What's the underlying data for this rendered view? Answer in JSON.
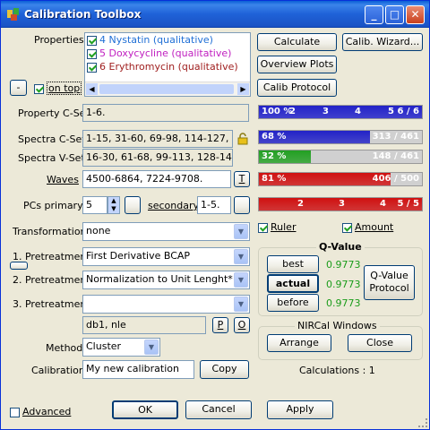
{
  "window": {
    "title": "Calibration Toolbox"
  },
  "properties": {
    "label": "Properties",
    "items": [
      {
        "label": "4 Nystatin (qualitative)",
        "color": "#1f6fd6",
        "checked": true
      },
      {
        "label": "5 Doxycycline (qualitative)",
        "color": "#c020c0",
        "checked": true
      },
      {
        "label": "6 Erythromycin (qualitative)",
        "color": "#a02020",
        "checked": true
      }
    ],
    "minus_label": "-",
    "ontop_label": "on top"
  },
  "buttons": {
    "calculate": "Calculate",
    "calib_wizard": "Calib. Wizard...",
    "overview_plots": "Overview Plots",
    "calib_protocol": "Calib Protocol",
    "ok": "OK",
    "cancel": "Cancel",
    "apply": "Apply",
    "best": "best",
    "actual": "actual",
    "before": "before",
    "qvalue_protocol_1": "Q-Value",
    "qvalue_protocol_2": "Protocol",
    "arrange": "Arrange",
    "close": "Close",
    "copy": "Copy",
    "t": "T",
    "p": "P",
    "o": "O"
  },
  "cset": {
    "property_label": "Property C-Set",
    "property_value": "1-6.",
    "spectra_c_label": "Spectra C-Set",
    "spectra_c_value": "1-15, 31-60, 69-98, 114-127, 143-",
    "spectra_v_label": "Spectra V-Set",
    "spectra_v_value": "16-30, 61-68, 99-113, 128-142, 17",
    "waves_label": "Waves",
    "waves_value": "4500-6864, 7224-9708."
  },
  "bars": [
    {
      "name": "property",
      "pct": 100,
      "left": "100 %",
      "right": "6 / 6",
      "ticks": [
        "2",
        "3",
        "4",
        "5"
      ],
      "color": "#2222c8"
    },
    {
      "name": "spectra-c",
      "pct": 68,
      "left": "68 %",
      "right": "313 / 461",
      "color": "#2222c8"
    },
    {
      "name": "spectra-v",
      "pct": 32,
      "left": "32 %",
      "right": "148 / 461",
      "color": "#22a022"
    },
    {
      "name": "waves",
      "pct": 81,
      "left": "81 %",
      "right": "406 / 500",
      "color": "#d01010"
    },
    {
      "name": "pcs",
      "pct": 100,
      "left": "",
      "right": "5 / 5",
      "ticks": [
        "2",
        "3",
        "4"
      ],
      "color": "#d01010"
    }
  ],
  "pcs": {
    "primary_label": "PCs primary",
    "primary_value": "5",
    "secondary_label": "secondary",
    "secondary_value": "1-5."
  },
  "transformation": {
    "label": "Transformation",
    "value": "none"
  },
  "pretreatment": [
    {
      "label": "1. Pretreatment",
      "value": "First Derivative BCAP"
    },
    {
      "label": "2. Pretreatment",
      "value": "Normalization to Unit Lenght*"
    },
    {
      "label": "3. Pretreatment",
      "value": ""
    }
  ],
  "pretreat_summary": "db1, nle",
  "method": {
    "label": "Method",
    "value": "Cluster"
  },
  "calibration": {
    "label": "Calibration",
    "value": "My new calibration"
  },
  "checks": {
    "ruler": "Ruler",
    "amount": "Amount",
    "advanced": "Advanced"
  },
  "qvalue": {
    "title": "Q-Value",
    "best": "0.9773",
    "actual": "0.9773",
    "before": "0.9773"
  },
  "nircal": {
    "title": "NIRCal Windows"
  },
  "calculations": "Calculations : 1"
}
